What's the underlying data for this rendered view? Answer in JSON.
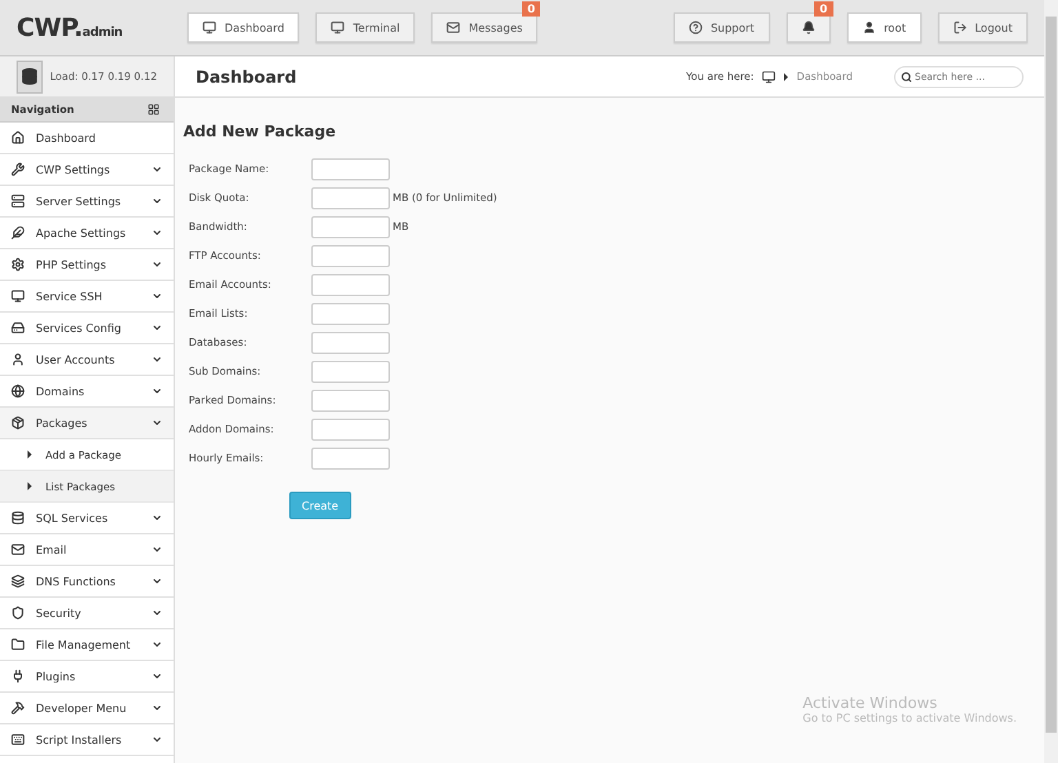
{
  "brand": {
    "name": "CWP.",
    "suffix": "admin"
  },
  "top_tabs": [
    {
      "label": "Dashboard",
      "selected": true
    },
    {
      "label": "Terminal",
      "selected": false
    },
    {
      "label": "Messages",
      "selected": false,
      "badge": "0"
    }
  ],
  "top_right": [
    {
      "kind": "support",
      "label": "Support"
    },
    {
      "kind": "bell",
      "badge": "0"
    },
    {
      "kind": "user",
      "label": "root"
    },
    {
      "kind": "logout",
      "label": "Logout"
    }
  ],
  "load": "Load: 0.17  0.19  0.12",
  "page_title": "Dashboard",
  "breadcrumb": {
    "prefix": "You are here:",
    "current": "Dashboard"
  },
  "search": {
    "placeholder": "Search here ..."
  },
  "navigation": {
    "title": "Navigation",
    "items": [
      {
        "label": "Dashboard",
        "has_menu": false
      },
      {
        "label": "CWP Settings",
        "has_menu": true
      },
      {
        "label": "Server Settings",
        "has_menu": true
      },
      {
        "label": "Apache Settings",
        "has_menu": true
      },
      {
        "label": "PHP Settings",
        "has_menu": true
      },
      {
        "label": "Service SSH",
        "has_menu": true
      },
      {
        "label": "Services Config",
        "has_menu": true
      },
      {
        "label": "User Accounts",
        "has_menu": true
      },
      {
        "label": "Domains",
        "has_menu": true
      },
      {
        "label": "Packages",
        "has_menu": true,
        "children": [
          {
            "label": "Add a Package",
            "selected": true
          },
          {
            "label": "List Packages",
            "selected": false
          }
        ]
      },
      {
        "label": "SQL Services",
        "has_menu": true
      },
      {
        "label": "Email",
        "has_menu": true
      },
      {
        "label": "DNS Functions",
        "has_menu": true
      },
      {
        "label": "Security",
        "has_menu": true
      },
      {
        "label": "File Management",
        "has_menu": true
      },
      {
        "label": "Plugins",
        "has_menu": true
      },
      {
        "label": "Developer Menu",
        "has_menu": true
      },
      {
        "label": "Script Installers",
        "has_menu": true
      }
    ]
  },
  "form": {
    "title": "Add New Package",
    "fields": [
      {
        "label": "Package Name:"
      },
      {
        "label": "Disk Quota:",
        "suffix": "MB (0 for Unlimited)"
      },
      {
        "label": "Bandwidth:",
        "suffix": "MB"
      },
      {
        "label": "FTP Accounts:"
      },
      {
        "label": "Email Accounts:"
      },
      {
        "label": "Email Lists:"
      },
      {
        "label": "Databases:"
      },
      {
        "label": "Sub Domains:"
      },
      {
        "label": "Parked Domains:"
      },
      {
        "label": "Addon Domains:"
      },
      {
        "label": "Hourly Emails:"
      }
    ],
    "submit": "Create"
  },
  "system_notice": {
    "title": "Activate Windows",
    "text": "Go to PC settings to activate Windows."
  }
}
